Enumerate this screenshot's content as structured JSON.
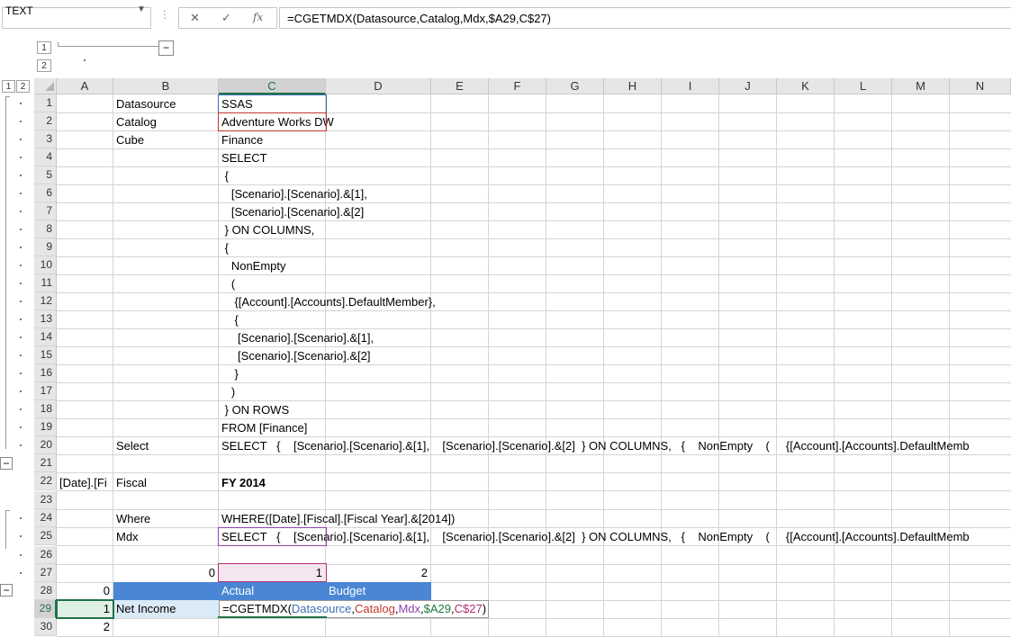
{
  "name_box": {
    "value": "TEXT"
  },
  "formula_bar": {
    "cancel_glyph": "✕",
    "enter_glyph": "✓",
    "fx_glyph": "fx",
    "content": "=CGETMDX(Datasource,Catalog,Mdx,$A29,C$27)"
  },
  "outline": {
    "col_levels": [
      "1",
      "2"
    ],
    "row_levels": [
      "1",
      "2"
    ],
    "minus": "−"
  },
  "columns": [
    "A",
    "B",
    "C",
    "D",
    "E",
    "F",
    "G",
    "H",
    "I",
    "J",
    "K",
    "L",
    "M",
    "N"
  ],
  "rows": [
    "1",
    "2",
    "3",
    "4",
    "5",
    "6",
    "7",
    "8",
    "9",
    "10",
    "11",
    "12",
    "13",
    "14",
    "15",
    "16",
    "17",
    "18",
    "19",
    "20",
    "21",
    "22",
    "23",
    "24",
    "25",
    "26",
    "27",
    "28",
    "29",
    "30"
  ],
  "cells": {
    "b1": "Datasource",
    "c1": "SSAS",
    "b2": "Catalog",
    "c2": "Adventure Works DW",
    "b3": "Cube",
    "c3": "Finance",
    "c4": "SELECT",
    "c5": " {",
    "c6": "   [Scenario].[Scenario].&[1],",
    "c7": "   [Scenario].[Scenario].&[2]",
    "c8": " } ON COLUMNS,",
    "c9": " {",
    "c10": "   NonEmpty",
    "c11": "   (",
    "c12": "    {[Account].[Accounts].DefaultMember},",
    "c13": "    {",
    "c14": "     [Scenario].[Scenario].&[1],",
    "c15": "     [Scenario].[Scenario].&[2]",
    "c16": "    }",
    "c17": "   )",
    "c18": " } ON ROWS",
    "c19": "FROM [Finance]",
    "b20": "Select",
    "c20": "SELECT   {    [Scenario].[Scenario].&[1],    [Scenario].[Scenario].&[2]  } ON COLUMNS,   {    NonEmpty    (     {[Account].[Accounts].DefaultMemb",
    "a22": "[Date].[Fi",
    "b22": "Fiscal",
    "c22": "FY 2014",
    "b24": "Where",
    "c24": "WHERE([Date].[Fiscal].[Fiscal Year].&[2014])",
    "b25": "Mdx",
    "c25": "SELECT   {    [Scenario].[Scenario].&[1],    [Scenario].[Scenario].&[2]  } ON COLUMNS,   {    NonEmpty    (     {[Account].[Accounts].DefaultMemb",
    "b27": "0",
    "c27": "1",
    "d27": "2",
    "a28": "0",
    "c28": "Actual",
    "d28": "Budget",
    "a29": "1",
    "b29": "Net Income",
    "a30": "2"
  },
  "edit_formula": {
    "prefix": "=CGETMDX(",
    "arg1": "Datasource",
    "comma1": ",",
    "arg2": "Catalog",
    "comma2": ",",
    "arg3": "Mdx",
    "comma3": ",",
    "arg4": "$A29",
    "comma4": ",",
    "arg5": "C$27",
    "suffix": ")"
  },
  "colors": {
    "header_fill": "#4a86d4",
    "header_text": "#ffffff",
    "selected_fill": "#dbeaf7",
    "ref_pink_fill": "#f4e6ee",
    "selection_green": "#217346",
    "ref_blue": "#3c6fb4",
    "ref_red": "#c0392b",
    "ref_purple": "#8e44ad",
    "ref_magenta": "#b03070"
  }
}
